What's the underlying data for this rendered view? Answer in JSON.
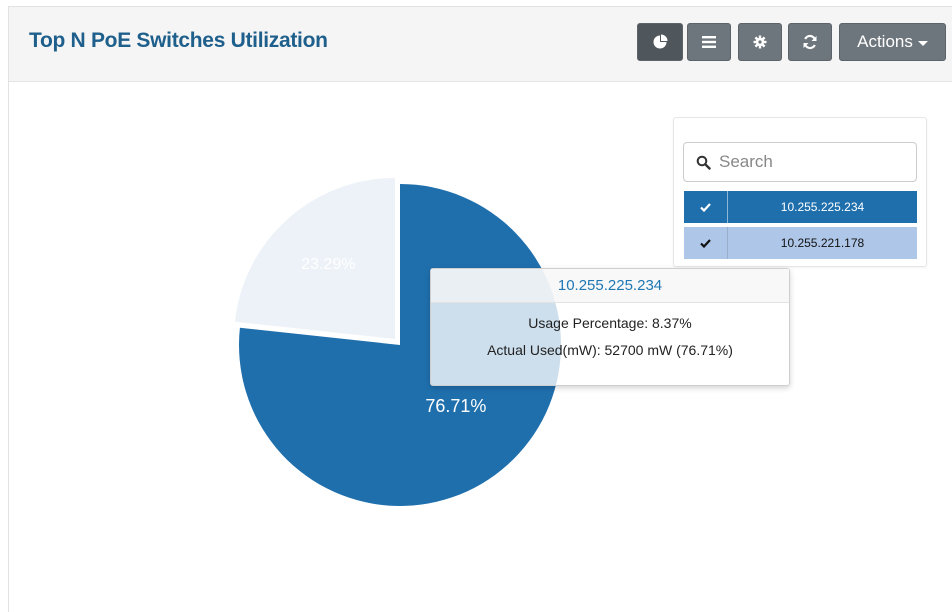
{
  "header": {
    "title": "Top N PoE Switches Utilization",
    "actions_label": "Actions"
  },
  "toolbar": {
    "buttons": [
      {
        "icon": "pie-chart-icon",
        "active": true
      },
      {
        "icon": "list-icon",
        "active": false
      },
      {
        "icon": "gear-icon",
        "active": false
      },
      {
        "icon": "refresh-icon",
        "active": false
      }
    ]
  },
  "legend": {
    "search_placeholder": "Search",
    "items": [
      {
        "label": "10.255.225.234",
        "checked": true,
        "color": "#1f6fad"
      },
      {
        "label": "10.255.221.178",
        "checked": true,
        "color": "#aec7e8"
      }
    ]
  },
  "tooltip": {
    "title": "10.255.225.234",
    "line1": "Usage Percentage: 8.37%",
    "line2": "Actual Used(mW): 52700 mW (76.71%)"
  },
  "chart_data": {
    "type": "pie",
    "categories": [
      "10.255.225.234",
      "10.255.221.178"
    ],
    "values": [
      76.71,
      23.29
    ],
    "labels": [
      "76.71%",
      "23.29%"
    ],
    "colors": [
      "#1f6fad",
      "#edf2f8"
    ]
  }
}
